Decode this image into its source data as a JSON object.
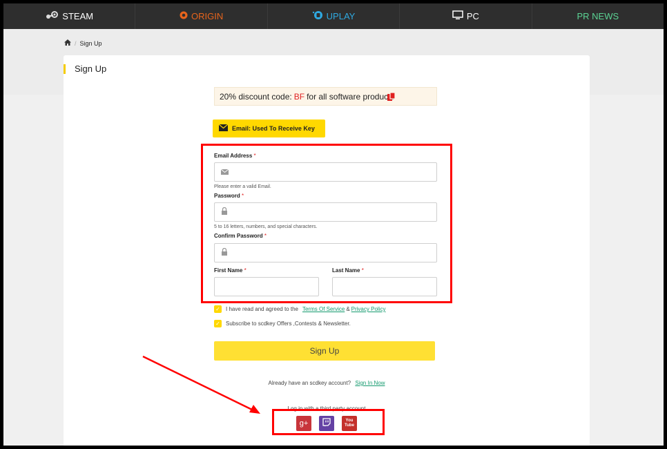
{
  "nav": {
    "items": [
      {
        "label": "STEAM",
        "icon": "steam-icon"
      },
      {
        "label": "ORIGIN",
        "icon": "origin-icon"
      },
      {
        "label": "UPLAY",
        "icon": "uplay-icon"
      },
      {
        "label": "PC",
        "icon": "monitor-icon"
      },
      {
        "label": "PR NEWS"
      }
    ]
  },
  "breadcrumb": {
    "home_icon": "home-icon",
    "separator": "/",
    "current": "Sign Up"
  },
  "page": {
    "title": "Sign Up"
  },
  "discount": {
    "prefix": "20% discount code:",
    "code": "BF",
    "suffix": "for all software products"
  },
  "email_badge": {
    "label": "Email: Used To Receive Key"
  },
  "form": {
    "email": {
      "label": "Email Address",
      "required": "*",
      "hint": "Please enter a valid Email."
    },
    "password": {
      "label": "Password",
      "required": "*",
      "hint": "5 to 16 letters, numbers, and special characters."
    },
    "confirm": {
      "label": "Confirm Password",
      "required": "*"
    },
    "first_name": {
      "label": "First Name",
      "required": "*"
    },
    "last_name": {
      "label": "Last Name",
      "required": "*"
    }
  },
  "agree": {
    "text": "I have read and agreed to the",
    "terms": "Terms Of Service",
    "amp": "&",
    "privacy": "Privacy Policy"
  },
  "subscribe": {
    "text": "Subscribe to scdkey Offers ,Contests & Newsletter."
  },
  "signup_button": "Sign Up",
  "already": {
    "text": "Already have an scdkey account?",
    "link": "Sign In Now"
  },
  "third_party": {
    "text": "Log in with a third party account",
    "youtube_text": "You Tube",
    "google_text": "g+"
  },
  "colors": {
    "accent": "#ffd800",
    "red_annotation": "#ff0000",
    "link": "#149a6e"
  }
}
